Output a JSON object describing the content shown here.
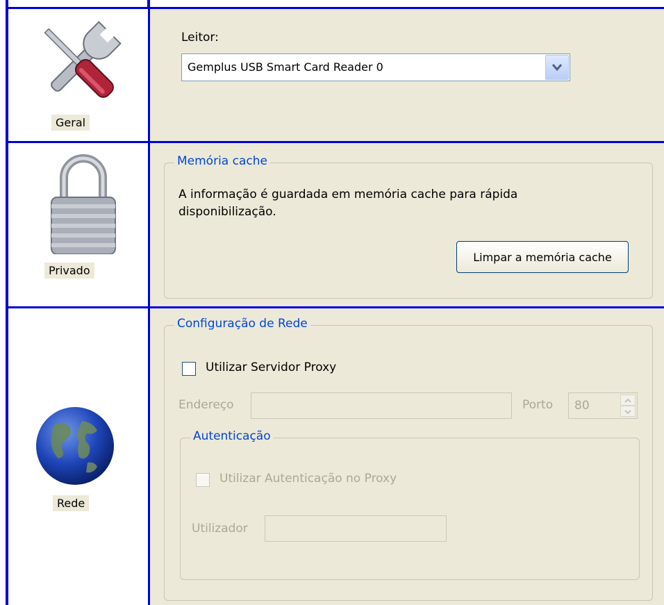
{
  "sidebar": {
    "items": [
      {
        "label": "Geral",
        "icon": "tools-icon"
      },
      {
        "label": "Privado",
        "icon": "padlock-icon"
      },
      {
        "label": "Rede",
        "icon": "globe-icon"
      }
    ]
  },
  "geral": {
    "reader_label": "Leitor:",
    "reader_value": "Gemplus USB Smart Card Reader 0"
  },
  "privado": {
    "group_title": "Memória cache",
    "description_line1": "A informação é guardada em memória cache para rápida",
    "description_line2": "disponibilização.",
    "clear_button": "Limpar a memória cache"
  },
  "rede": {
    "group_title": "Configuração de Rede",
    "use_proxy_label": "Utilizar Servidor Proxy",
    "address_label": "Endereço",
    "address_value": "",
    "port_label": "Porto",
    "port_value": "80",
    "auth": {
      "group_title": "Autenticação",
      "use_auth_label": "Utilizar Autenticação no Proxy",
      "user_label": "Utilizador",
      "user_value": ""
    }
  },
  "colors": {
    "grid_line": "#0000dd",
    "panel_bg": "#ece9d8",
    "group_title": "#0046d5",
    "disabled_text": "#aca899"
  }
}
